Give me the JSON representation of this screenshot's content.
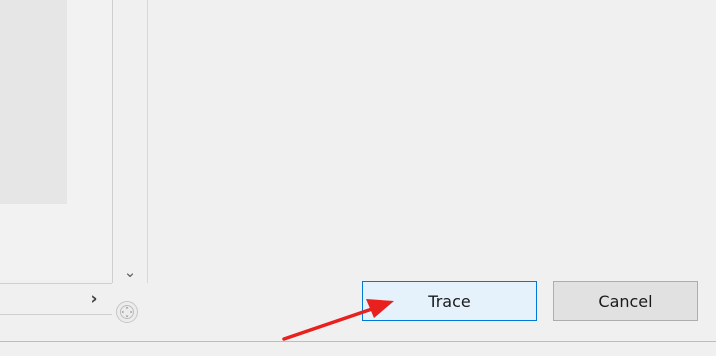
{
  "dialog": {
    "buttons": {
      "trace_label": "Trace",
      "cancel_label": "Cancel"
    }
  },
  "scrollbars": {
    "down_arrow": "⌄",
    "right_arrow": "›"
  },
  "icons": {
    "pan": "pan-icon",
    "scroll_down": "chevron-down-icon",
    "scroll_right": "chevron-right-icon",
    "annotation": "red-arrow-annotation"
  },
  "colors": {
    "annotation_red": "#e8201e",
    "focus_blue": "#0078d7",
    "primary_button_fill": "#e5f1fb"
  }
}
